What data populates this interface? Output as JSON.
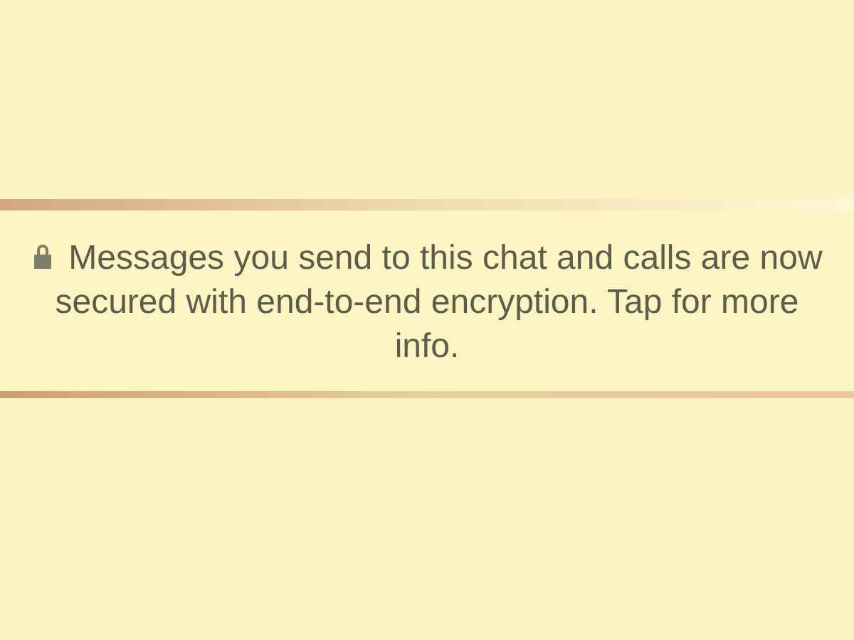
{
  "encryption_notice": {
    "text": "Messages you send to this chat and calls are now secured with end-to-end encryption. Tap for more info."
  }
}
